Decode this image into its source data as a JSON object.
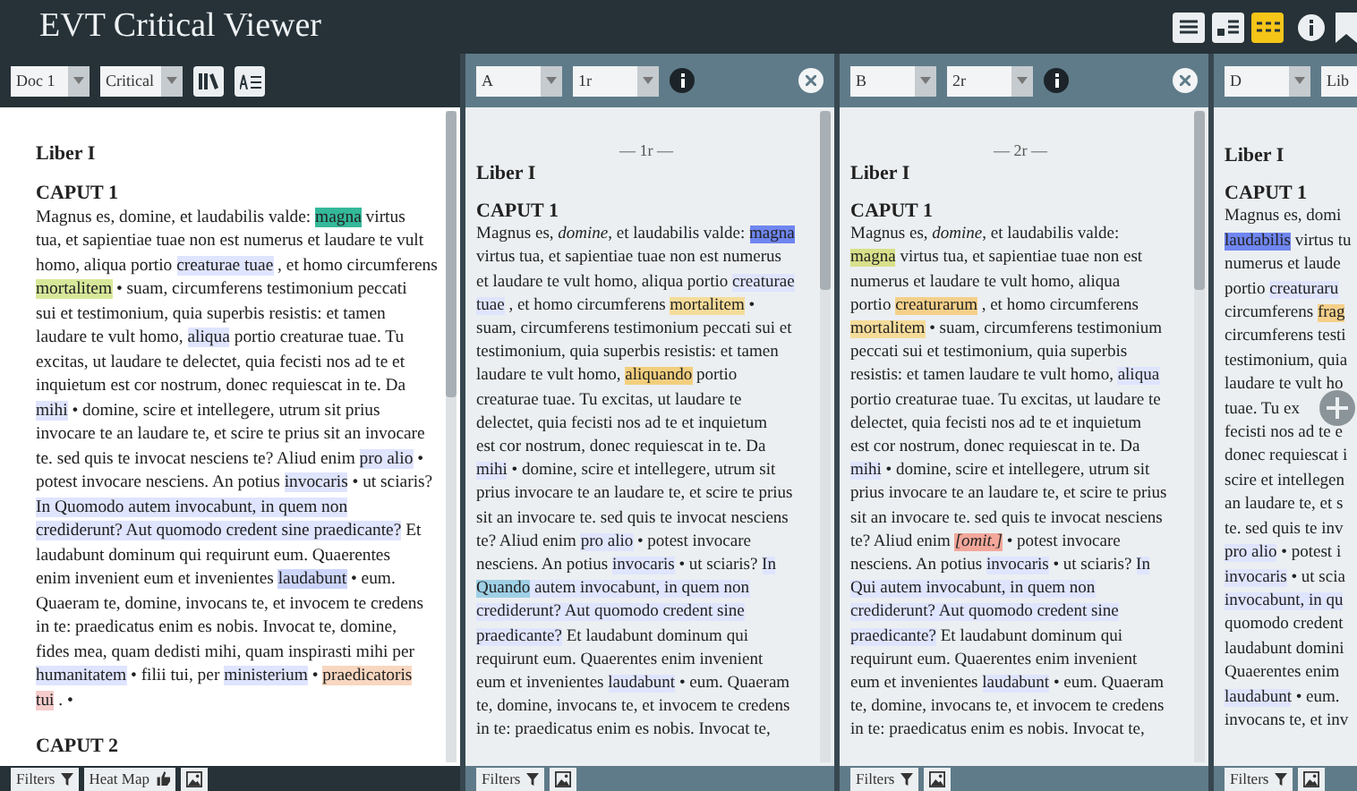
{
  "app": {
    "title": "EVT Critical Viewer",
    "views": [
      {
        "kind": "single",
        "selected": false
      },
      {
        "kind": "split",
        "selected": false
      },
      {
        "kind": "triple",
        "selected": true
      }
    ]
  },
  "critical_panel": {
    "document": "Doc 1",
    "edition": "Critical",
    "book": "Liber I",
    "chapter": "CAPUT 1",
    "lines": [
      [
        {
          "text": "Magnus es, domine, et laudabilis valde: "
        },
        {
          "text": "magna",
          "color": "#34b89a"
        },
        {
          "text": " virtus"
        }
      ],
      [
        {
          "text": "tua, et sapientiae tuae non est numerus et laudare te vult"
        }
      ],
      [
        {
          "text": "homo, aliqua portio "
        },
        {
          "text": "creaturae tuae",
          "color": "#dfe4ff"
        },
        {
          "text": " , et homo circumferens"
        }
      ],
      [
        {
          "text": "mortalitem",
          "color": "#d8e89a"
        },
        {
          "text": " • suam, circumferens testimonium peccati"
        }
      ],
      [
        {
          "text": "sui et testimonium, quia superbis resistis: et tamen"
        }
      ],
      [
        {
          "text": "laudare te vult homo, "
        },
        {
          "text": "aliqua",
          "color": "#dfe4ff"
        },
        {
          "text": " portio creaturae tuae. Tu"
        }
      ],
      [
        {
          "text": "excitas, ut laudare te delectet, quia fecisti nos ad te et"
        }
      ],
      [
        {
          "text": "inquietum est cor nostrum, donec requiescat in te. Da"
        }
      ],
      [
        {
          "text": "mihi",
          "color": "#dfe4ff"
        },
        {
          "text": " • domine, scire et intellegere, utrum sit prius"
        }
      ],
      [
        {
          "text": "invocare te an laudare te, et scire te prius sit an invocare"
        }
      ],
      [
        {
          "text": "te. sed quis te invocat nesciens te? Aliud enim "
        },
        {
          "text": "pro alio",
          "color": "#dfe4ff"
        },
        {
          "text": " •"
        }
      ],
      [
        {
          "text": "potest invocare nesciens. An potius "
        },
        {
          "text": "invocaris",
          "color": "#dfe4ff"
        },
        {
          "text": " • ut sciaris?"
        }
      ],
      [
        {
          "text": "In Quomodo autem invocabunt, in quem non",
          "color": "#dfe4ff"
        }
      ],
      [
        {
          "text": "crediderunt? Aut quomodo credent sine praedicante?",
          "color": "#dfe4ff"
        },
        {
          "text": " Et"
        }
      ],
      [
        {
          "text": "laudabunt dominum qui requirunt eum. Quaerentes"
        }
      ],
      [
        {
          "text": "enim invenient eum et invenientes "
        },
        {
          "text": "laudabunt",
          "color": "#cdd6fb"
        },
        {
          "text": " • eum."
        }
      ],
      [
        {
          "text": "Quaeram te, domine, invocans te, et invocem te credens"
        }
      ],
      [
        {
          "text": "in te: praedicatus enim es nobis. Invocat te, domine,"
        }
      ],
      [
        {
          "text": "fides mea, quam dedisti mihi, quam inspirasti mihi per"
        }
      ],
      [
        {
          "text": "humanitatem",
          "color": "#dfe4ff"
        },
        {
          "text": " • filii tui, per "
        },
        {
          "text": "ministerium",
          "color": "#dfe4ff"
        },
        {
          "text": " • "
        },
        {
          "text": "praedicatoris",
          "color": "#f8d7c0"
        }
      ],
      [
        {
          "text": "tui",
          "color": "#f6cccc"
        },
        {
          "text": " . •"
        }
      ]
    ],
    "next_chapter": "CAPUT 2",
    "footer": [
      "Filters",
      "Heat Map"
    ]
  },
  "witness_panels": [
    {
      "witness": "A",
      "footer": "Filters",
      "page": "1r",
      "page_label": "— 1r —",
      "book": "Liber I",
      "chapter": "CAPUT 1",
      "closable": true,
      "lines": [
        [
          {
            "text": "Magnus es, *domine*, et laudabilis valde: "
          },
          {
            "text": "magna",
            "color": "#6f86f0"
          }
        ],
        [
          {
            "text": "virtus tua, et sapientiae tuae non est numerus"
          }
        ],
        [
          {
            "text": "et laudare te vult homo, aliqua portio "
          },
          {
            "text": "creaturae",
            "color": "#dfe4ff"
          }
        ],
        [
          {
            "text": "tuae",
            "color": "#dfe4ff"
          },
          {
            "text": " , et homo circumferens "
          },
          {
            "text": "mortalitem",
            "color": "#f5dc9a"
          },
          {
            "text": " •"
          }
        ],
        [
          {
            "text": "suam, circumferens testimonium peccati sui et"
          }
        ],
        [
          {
            "text": "testimonium, quia superbis resistis: et tamen"
          }
        ],
        [
          {
            "text": "laudare te vult homo, "
          },
          {
            "text": "aliquando",
            "color": "#f2cf7e"
          },
          {
            "text": " portio"
          }
        ],
        [
          {
            "text": "creaturae tuae. Tu excitas, ut laudare te"
          }
        ],
        [
          {
            "text": "delectet, quia fecisti nos ad te et inquietum"
          }
        ],
        [
          {
            "text": "est cor nostrum, donec requiescat in te. Da"
          }
        ],
        [
          {
            "text": "mihi",
            "color": "#dfe4ff"
          },
          {
            "text": " • domine, scire et intellegere, utrum sit"
          }
        ],
        [
          {
            "text": "prius invocare te an laudare te, et scire te prius"
          }
        ],
        [
          {
            "text": "sit an invocare te. sed quis te invocat nesciens"
          }
        ],
        [
          {
            "text": "te? Aliud enim "
          },
          {
            "text": "pro alio",
            "color": "#dfe4ff"
          },
          {
            "text": " • potest invocare"
          }
        ],
        [
          {
            "text": "nesciens. An potius "
          },
          {
            "text": "invocaris",
            "color": "#dfe4ff"
          },
          {
            "text": " • ut sciaris? "
          },
          {
            "text": "In",
            "color": "#dfe4ff"
          }
        ],
        [
          {
            "text": "Quando",
            "color": "#9fd0e6"
          },
          {
            "text": " autem invocabunt, in quem non",
            "color": "#dfe4ff"
          }
        ],
        [
          {
            "text": "crediderunt? Aut quomodo credent sine",
            "color": "#dfe4ff"
          }
        ],
        [
          {
            "text": "praedicante?",
            "color": "#dfe4ff"
          },
          {
            "text": " Et laudabunt dominum qui"
          }
        ],
        [
          {
            "text": "requirunt eum. Quaerentes enim invenient"
          }
        ],
        [
          {
            "text": "eum et invenientes "
          },
          {
            "text": "laudabunt",
            "color": "#dfe4ff"
          },
          {
            "text": " • eum. Quaeram"
          }
        ],
        [
          {
            "text": "te, domine, invocans te, et invocem te credens"
          }
        ],
        [
          {
            "text": "in te: praedicatus enim es nobis. Invocat te,"
          }
        ]
      ]
    },
    {
      "witness": "B",
      "footer": "Filters",
      "page": "2r",
      "page_label": "— 2r —",
      "book": "Liber I",
      "chapter": "CAPUT 1",
      "closable": true,
      "lines": [
        [
          {
            "text": "Magnus es, *domine*, et laudabilis valde:"
          }
        ],
        [
          {
            "text": "magna",
            "color": "#d8e08a"
          },
          {
            "text": " virtus tua, et sapientiae tuae non est"
          }
        ],
        [
          {
            "text": "numerus et laudare te vult homo, aliqua"
          }
        ],
        [
          {
            "text": "portio "
          },
          {
            "text": "creaturarum",
            "color": "#f5d08a"
          },
          {
            "text": " , et homo circumferens"
          }
        ],
        [
          {
            "text": "mortalitem",
            "color": "#f5dc9a"
          },
          {
            "text": " • suam, circumferens testimonium"
          }
        ],
        [
          {
            "text": "peccati sui et testimonium, quia superbis"
          }
        ],
        [
          {
            "text": "resistis: et tamen laudare te vult homo, "
          },
          {
            "text": "aliqua",
            "color": "#dfe4ff"
          }
        ],
        [
          {
            "text": "portio creaturae tuae. Tu excitas, ut laudare te"
          }
        ],
        [
          {
            "text": "delectet, quia fecisti nos ad te et inquietum"
          }
        ],
        [
          {
            "text": "est cor nostrum, donec requiescat in te. Da"
          }
        ],
        [
          {
            "text": "mihi",
            "color": "#dfe4ff"
          },
          {
            "text": " • domine, scire et intellegere, utrum sit"
          }
        ],
        [
          {
            "text": "prius invocare te an laudare te, et scire te prius"
          }
        ],
        [
          {
            "text": "sit an invocare te. sed quis te invocat nesciens"
          }
        ],
        [
          {
            "text": "te? Aliud enim "
          },
          {
            "text": "*[omit.]*",
            "color": "#f2a79a"
          },
          {
            "text": " • potest invocare"
          }
        ],
        [
          {
            "text": "nesciens. An potius "
          },
          {
            "text": "invocaris",
            "color": "#dfe4ff"
          },
          {
            "text": " • ut sciaris? "
          },
          {
            "text": "In",
            "color": "#dfe4ff"
          }
        ],
        [
          {
            "text": "Qui autem invocabunt, in quem non",
            "color": "#dfe4ff"
          }
        ],
        [
          {
            "text": "crediderunt? Aut quomodo credent sine",
            "color": "#dfe4ff"
          }
        ],
        [
          {
            "text": "praedicante?",
            "color": "#dfe4ff"
          },
          {
            "text": " Et laudabunt dominum qui"
          }
        ],
        [
          {
            "text": "requirunt eum. Quaerentes enim invenient"
          }
        ],
        [
          {
            "text": "eum et invenientes "
          },
          {
            "text": "laudabunt",
            "color": "#dfe4ff"
          },
          {
            "text": " • eum. Quaeram"
          }
        ],
        [
          {
            "text": "te, domine, invocans te, et invocem te credens"
          }
        ],
        [
          {
            "text": "in te: praedicatus enim es nobis. Invocat te,"
          }
        ]
      ]
    },
    {
      "witness": "D",
      "footer": "Filters",
      "page": "Lib",
      "book": "Liber I",
      "chapter": "CAPUT 1",
      "closable": false,
      "lines": [
        [
          {
            "text": "Magnus es, domi"
          }
        ],
        [
          {
            "text": "laudabilis",
            "color": "#6f86f0"
          },
          {
            "text": " virtus tu"
          }
        ],
        [
          {
            "text": "numerus et laude"
          }
        ],
        [
          {
            "text": "portio "
          },
          {
            "text": "creaturaru",
            "color": "#dfe4ff"
          }
        ],
        [
          {
            "text": "circumferens "
          },
          {
            "text": "frag",
            "color": "#f5d08a"
          }
        ],
        [
          {
            "text": "circumferens testi"
          }
        ],
        [
          {
            "text": "testimonium, quia"
          }
        ],
        [
          {
            "text": "laudare te vult ho"
          }
        ],
        [
          {
            "text": "tuae. Tu ex"
          }
        ],
        [
          {
            "text": "fecisti nos ad te e"
          }
        ],
        [
          {
            "text": "donec requiescat i"
          }
        ],
        [
          {
            "text": "scire et intellegen"
          }
        ],
        [
          {
            "text": "an laudare te, et s"
          }
        ],
        [
          {
            "text": "te. sed quis te inv"
          }
        ],
        [
          {
            "text": "pro alio",
            "color": "#dfe4ff"
          },
          {
            "text": " • potest i"
          }
        ],
        [
          {
            "text": "invocaris",
            "color": "#dfe4ff"
          },
          {
            "text": " • ut scia"
          }
        ],
        [
          {
            "text": "invocabunt, in qu",
            "color": "#dfe4ff"
          }
        ],
        [
          {
            "text": "quomodo credent"
          }
        ],
        [
          {
            "text": "laudabunt domini"
          }
        ],
        [
          {
            "text": "Quaerentes enim"
          }
        ],
        [
          {
            "text": "laudabunt",
            "color": "#dfe4ff"
          },
          {
            "text": " • eum."
          }
        ],
        [
          {
            "text": "invocans te, et inv"
          }
        ]
      ]
    }
  ]
}
